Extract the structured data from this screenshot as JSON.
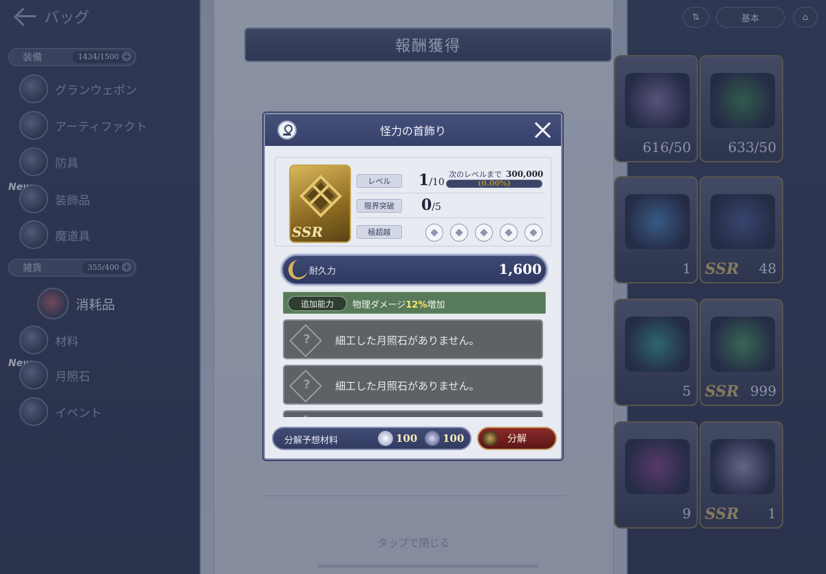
{
  "background": {
    "back_label": "バッグ",
    "equipment": {
      "label": "装備",
      "count": "1434/1500"
    },
    "equipment_items": [
      "グランウェポン",
      "アーティファクト",
      "防具",
      "装飾品",
      "魔道具"
    ],
    "goods": {
      "label": "雑貨",
      "count": "355/400"
    },
    "goods_items": [
      "消耗品",
      "材料",
      "月照石",
      "イベント"
    ],
    "new_badge": "New",
    "reward_title": "報酬獲得",
    "tap_to_close": "タップで閉じる",
    "sort_mode": "基本",
    "chest_counts": [
      "616/50",
      "633/50",
      "1",
      "48",
      "5",
      "999",
      "9",
      "1"
    ],
    "ssr_label": "SSR"
  },
  "modal": {
    "title": "怪力の首飾り",
    "item_rarity": "SSR",
    "level_label": "レベル",
    "level_value": "1",
    "level_max": "/10",
    "next_level_label": "次のレベルまで",
    "next_level_exp": "300,000",
    "exp_progress_text": "(0.00%)",
    "exp_progress": 0.0,
    "limit_break_label": "限界突破",
    "limit_break_value": "0",
    "limit_break_max": "/5",
    "transcend_label": "極超越",
    "transcend_slots": 5,
    "durability_label": "耐久力",
    "durability_value": "1,600",
    "extra_ability_tag": "追加能力",
    "extra_ability_prefix": "物理ダメージ",
    "extra_ability_highlight": "12%",
    "extra_ability_suffix": "増加",
    "moonstone_slots": [
      "細工した月照石がありません。",
      "細工した月照石がありません。"
    ],
    "dismantle_materials_label": "分解予想材料",
    "material_1_count": "100",
    "material_2_count": "100",
    "dismantle_button": "分解"
  },
  "colors": {
    "header": "#3c4670",
    "extra_ability": "#577a5a",
    "highlight": "#ffe56b",
    "dismantle": "#7a2222"
  }
}
